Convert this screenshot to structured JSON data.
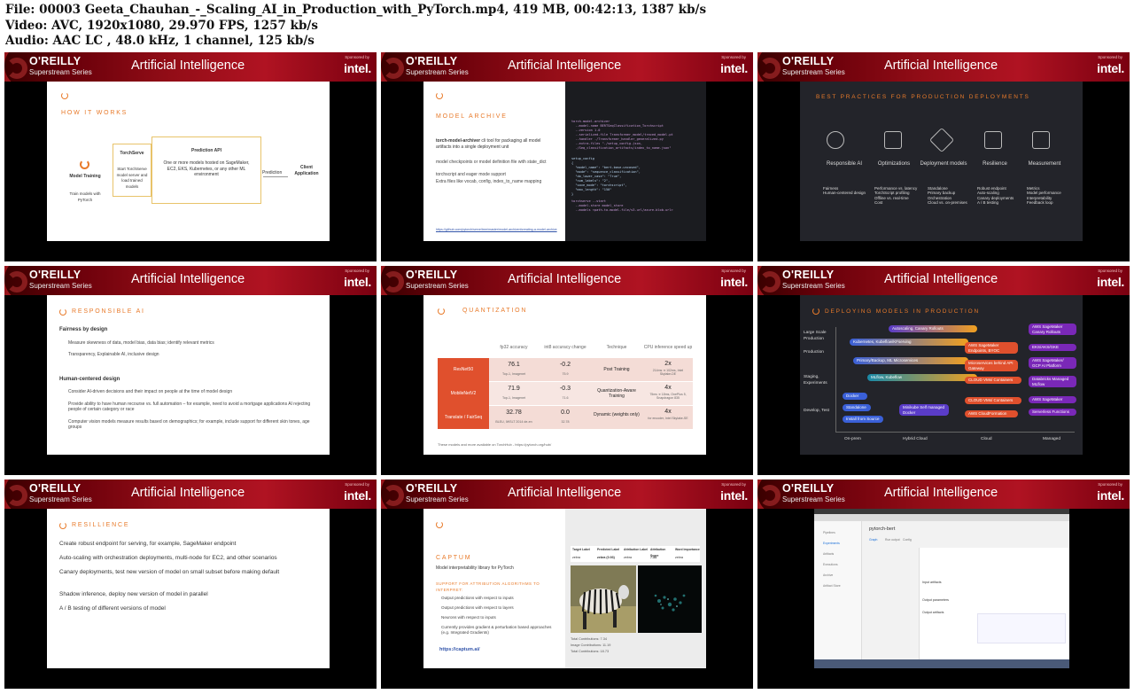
{
  "header": {
    "file_line": "File: 00003 Geeta_Chauhan_-_Scaling_AI_in_Production_with_PyTorch.mp4, 419 MB, 00:42:13, 1387 kb/s",
    "video_line": "Video: AVC, 1920x1080, 29.970 FPS, 1257 kb/s",
    "audio_line": "Audio: AAC LC , 48.0 kHz, 1 channel, 125 kb/s"
  },
  "banner": {
    "brand": "O'REILLY",
    "series": "Superstream Series",
    "title": "Artificial Intelligence",
    "sponsor_label": "Sponsored by",
    "sponsor": "intel."
  },
  "slides": {
    "how": {
      "title": "HOW IT WORKS",
      "model_training": "Model Training",
      "train_sub": "Train models with PyTorch",
      "torchserve": "TorchServe",
      "torchserve_sub": "Start TorchServe model server and load trained models",
      "prediction_api": "Prediction API",
      "prediction_sub": "One or more models hosted on SageMaker, EC2, EKS, Kubernetes, or any other ML environment",
      "prediction": "Prediction",
      "client": "Client Application"
    },
    "archive": {
      "title": "MODEL ARCHIVE",
      "intro_bold": "torch-model-archiver",
      "intro": "cli tool for packaging all model artifacts into a single deployment unit",
      "bullets": [
        "model checkpoints or model definition file with state_dict",
        "torchscript and eager mode support",
        "Extra files like vocab, config, index_to_name mapping"
      ],
      "link": "https://github.com/pytorch/serve/tree/master/model-archiver#creating-a-model-archive",
      "code1": "torch-model-archiver\n  --model-name BERTSeqClassification_Torchscript\n  --version 1.0\n  --serialized-file Transformer_model/traced_model.pt\n  --handler ./Transformer_handler_generalized.py\n  --extra-files \"./setup_config.json,\n  ./Seq_classification_artifacts/index_to_name.json\"",
      "code2": "setup_config\n{\n  \"model_name\": \"bert-base-uncased\",\n  \"mode\": \"sequence_classification\",\n  \"do_lower_case\": \"True\",\n  \"num_labels\": \"2\",\n  \"save_mode\": \"torchscript\",\n  \"max_length\": \"150\"\n}",
      "code3": "torchserve --start\n  --model-store model_store\n  --models <path-to-model-file/s3-url/azure-blob-url>"
    },
    "best": {
      "title": "BEST PRACTICES FOR PRODUCTION DEPLOYMENTS",
      "cols": [
        {
          "name": "Responsible AI",
          "desc": "Fairness\nHuman-centered design"
        },
        {
          "name": "Optimizations",
          "desc": "Performance vs. latency\nTorchScript profiling\nOffline vs. real-time\nCost"
        },
        {
          "name": "Deployment models",
          "desc": "Standalone\nPrimary backup\nOrchestration\nCloud vs. on-premises"
        },
        {
          "name": "Resilience",
          "desc": "Robust endpoint\nAuto-scaling\nCanary deployments\nA / B testing"
        },
        {
          "name": "Measurement",
          "desc": "Metrics\nModel performance\nInterpretability\nFeedback loop"
        }
      ]
    },
    "resp": {
      "title": "RESPONSIBLE AI",
      "h1": "Fairness by design",
      "b1": [
        "Measure skewness of data, model bias, data bias; identify relevant metrics",
        "Transparency, Explainable AI, inclusive design"
      ],
      "h2": "Human-centered design",
      "b2": [
        "Consider AI-driven decisions and their impact on people at the time of model design",
        "Provide ability to have human recourse vs. full automation – for example, need to avoid a mortgage applications AI rejecting people of certain category or race",
        "Computer vision models measure results based on demographics; for example, include support for different skin tones, age groups"
      ]
    },
    "quant": {
      "title": "QUANTIZATION",
      "headers": [
        "fp32 accuracy",
        "int8 accuracy change",
        "Technique",
        "CPU inference speed up"
      ],
      "rows": [
        {
          "model": "ResNet50",
          "fp32": "76.1",
          "fp32_sub": "Top-1, Imagenet",
          "chg": "-0.2",
          "chg_sub": "75.9",
          "tech": "Post Training",
          "speed": "2x",
          "speed_sub": "214ms ➔ 102ms, Intel Skylake-DE"
        },
        {
          "model": "MobileNetV2",
          "fp32": "71.9",
          "fp32_sub": "Top-1, Imagenet",
          "chg": "-0.3",
          "chg_sub": "71.6",
          "tech": "Quantization-Aware Training",
          "speed": "4x",
          "speed_sub": "75ms ➔ 18ms, OnePlus 5, Snapdragon 835"
        },
        {
          "model": "Translate / FairSeq",
          "fp32": "32.78",
          "fp32_sub": "BLEU, IWSLT 2014 de-en",
          "chg": "0.0",
          "chg_sub": "32.78",
          "tech": "Dynamic (weights only)",
          "speed": "4x",
          "speed_sub": "for encoder, Intel Skylake-SE"
        }
      ],
      "footer": "These models and more available on TorchHub - https://pytorch.org/hub/"
    },
    "deploy": {
      "title": "DEPLOYING MODELS IN PRODUCTION",
      "ylabels": [
        "Large Scale Production",
        "Production",
        "Staging, Experiments",
        "Develop, Test"
      ],
      "xlabels": [
        "On-prem",
        "Hybrid Cloud",
        "Cloud",
        "Managed"
      ],
      "bars": [
        "Autoscaling, Canary Rollouts",
        "Kubernetes, Kubeflow/KFserving",
        "Primary/Backup, ML Microservices",
        "MLflow, Kubeflow"
      ],
      "cloud": [
        "AWS SageMaker Endpoints, BYOC",
        "Microservices behind API Gateway",
        "CLOUD VMs/ Containers",
        "CLOUD VMs/ Containers",
        "AWS CloudFormation"
      ],
      "managed": [
        "AWS SageMaker Canary Rollouts",
        "EKS/AKS/GKE",
        "AWS SageMaker/ GCP AI Platform",
        "Databricks Managed MLflow",
        "AWS SageMaker",
        "Serverless Functions"
      ],
      "local": [
        "Docker",
        "Standalone",
        "Install from Source",
        "Minikube Self managed Docker"
      ]
    },
    "resil": {
      "title": "RESILLIENCE",
      "items": [
        "Create robust endpoint for serving, for example, SageMaker endpoint",
        "Auto-scaling with orchestration deployments, multi-node for EC2, and other scenarios",
        "Canary deployments, test new version of model on small subset before making default",
        "Shadow inference, deploy new version of model in parallel",
        "A / B testing of different versions of model"
      ]
    },
    "captum": {
      "title": "CAPTUM",
      "subtitle": "Model interpretability library for PyTorch",
      "support": "SUPPORT FOR ATTRIBUTION ALGORITHMS TO INTERPRET:",
      "bullets": [
        "Output predictions with respect to inputs",
        "Output predictions with respect to layers",
        "Neurons with respect to inputs",
        "Currently provides gradient & perturbation based approaches (e.g. Integrated Gradients)"
      ],
      "link": "https://captum.ai/",
      "table_headers": [
        "Target Label",
        "Predicted Label",
        "Attribution Label",
        "Attribution Score",
        "Word Importance"
      ],
      "table_row": [
        "zebra",
        "zebra (0.93)",
        "zebra",
        "7.34",
        "zebra"
      ],
      "stats": [
        "Total Contributions: 7.34",
        "Image Contributions: 11.19",
        "Total Contributions: 18.73"
      ]
    },
    "pipe": {
      "breadcrumb": "pytorch-bert",
      "nav": [
        "Pipelines",
        "Experiments",
        "Artifacts",
        "Executions",
        "Archive",
        "Artifact Store"
      ],
      "tabs": [
        "Graph",
        "Run output",
        "Config"
      ],
      "sections": [
        "Input artifacts",
        "Output parameters",
        "Output artifacts"
      ]
    }
  }
}
